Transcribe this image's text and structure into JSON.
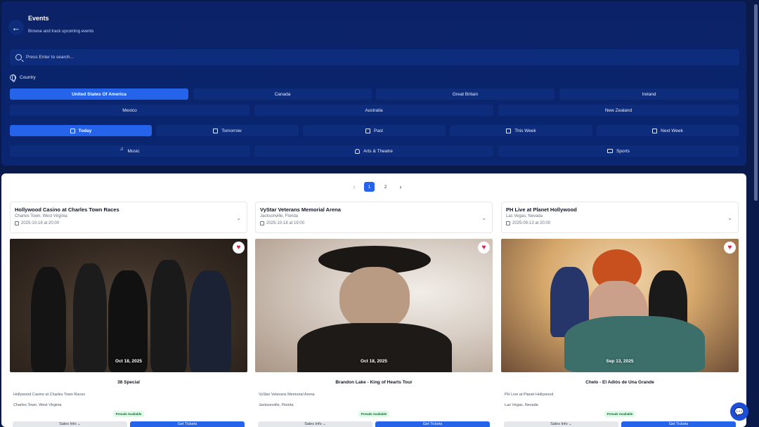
{
  "header": {
    "title": "Events",
    "subtitle": "Browse and track upcoming events",
    "back_label": "←"
  },
  "search": {
    "placeholder": "Press Enter to search..."
  },
  "country": {
    "label": "Country",
    "options": [
      "United States Of America",
      "Canada",
      "Great Britain",
      "Ireland",
      "Mexico",
      "Australia",
      "New Zealand"
    ],
    "selected": "United States Of America"
  },
  "time_filters": {
    "options": [
      "Today",
      "Tomorrow",
      "Past",
      "This Week",
      "Next Week"
    ],
    "selected": "Today"
  },
  "categories": [
    "Music",
    "Arts & Theatre",
    "Sports"
  ],
  "pagination": {
    "pages": [
      "1",
      "2"
    ],
    "current": "1",
    "prev": "‹",
    "next": "›"
  },
  "events": [
    {
      "venue": "Hollywood Casino at Charles Town Races",
      "location": "Charles Town, West Virginia",
      "datetime": "2025-10-18  at 20:00",
      "image_date": "Oct 18, 2025",
      "title": "38 Special",
      "badge": "Presale Available",
      "sales_label": "Sales Info ⌄",
      "tickets_label": "Get Tickets"
    },
    {
      "venue": "VyStar Veterans Memorial Arena",
      "location": "Jacksonville, Florida",
      "datetime": "2025-10-18  at 19:00",
      "image_date": "Oct 18, 2025",
      "title": "Brandon Lake - King of Hearts Tour",
      "badge": "Presale Available",
      "sales_label": "Sales Info ⌄",
      "tickets_label": "Get Tickets"
    },
    {
      "venue": "PH Live at Planet Hollywood",
      "location": "Las Vegas, Nevada",
      "datetime": "2025-09-13  at 20:00",
      "image_date": "Sep 13, 2025",
      "title": "Chelo - El Adiós de Una Grande",
      "badge": "Presale Available",
      "sales_label": "Sales Info ⌄",
      "tickets_label": "Get Tickets"
    }
  ],
  "colors": {
    "accent": "#2563eb",
    "hero_bg": "#0b2266",
    "chip_bg": "#0d2d7c"
  }
}
